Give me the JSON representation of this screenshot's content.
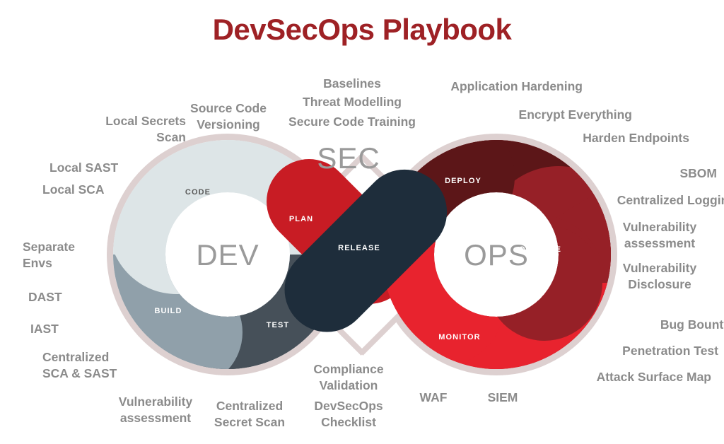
{
  "title": "DevSecOps Playbook",
  "colors": {
    "title": "#9e2125",
    "outer_ring": "#ddd0d0",
    "code": "#dde5e7",
    "build": "#90a0aa",
    "test": "#465059",
    "plan": "#c81c24",
    "release": "#1e2d3b",
    "deploy": "#5c1618",
    "operate": "#962027",
    "monitor": "#e8232e",
    "annotation_text": "#8b8b8b",
    "loop_label_text": "#9a9a9a",
    "background": "#ffffff"
  },
  "loops": {
    "dev": "DEV",
    "sec": "SEC",
    "ops": "OPS"
  },
  "segments": [
    {
      "id": "code",
      "label": "CODE",
      "color": "#dde5e7",
      "text_color": "#5a5a5a"
    },
    {
      "id": "build",
      "label": "BUILD",
      "color": "#90a0aa",
      "text_color": "#ffffff"
    },
    {
      "id": "test",
      "label": "TEST",
      "color": "#465059",
      "text_color": "#ffffff"
    },
    {
      "id": "plan",
      "label": "PLAN",
      "color": "#c81c24",
      "text_color": "#ffffff"
    },
    {
      "id": "release",
      "label": "RELEASE",
      "color": "#1e2d3b",
      "text_color": "#ffffff"
    },
    {
      "id": "deploy",
      "label": "DEPLOY",
      "color": "#5c1618",
      "text_color": "#ffffff"
    },
    {
      "id": "operate",
      "label": "OPERATE",
      "color": "#962027",
      "text_color": "#ffffff"
    },
    {
      "id": "monitor",
      "label": "MONITOR",
      "color": "#e8232e",
      "text_color": "#ffffff"
    }
  ],
  "annotations": {
    "top_left": [
      {
        "id": "local-secrets-scan",
        "text": "Local Secrets\nScan"
      },
      {
        "id": "source-code-versioning",
        "text": "Source Code\nVersioning"
      }
    ],
    "top_center": [
      {
        "id": "baselines",
        "text": "Baselines"
      },
      {
        "id": "threat-modelling",
        "text": "Threat Modelling"
      },
      {
        "id": "secure-code-training",
        "text": "Secure Code Training"
      }
    ],
    "top_right": [
      {
        "id": "application-hardening",
        "text": "Application Hardening"
      },
      {
        "id": "encrypt-everything",
        "text": "Encrypt Everything"
      },
      {
        "id": "harden-endpoints",
        "text": "Harden Endpoints"
      }
    ],
    "left": [
      {
        "id": "local-sast",
        "text": "Local SAST"
      },
      {
        "id": "local-sca",
        "text": "Local SCA"
      },
      {
        "id": "separate-envs",
        "text": "Separate\nEnvs"
      },
      {
        "id": "dast",
        "text": "DAST"
      },
      {
        "id": "iast",
        "text": "IAST"
      },
      {
        "id": "centralized-sca-sast",
        "text": "Centralized\nSCA & SAST"
      }
    ],
    "right": [
      {
        "id": "sbom",
        "text": "SBOM"
      },
      {
        "id": "centralized-logging",
        "text": "Centralized Logging"
      },
      {
        "id": "vulnerability-assessment-ops",
        "text": "Vulnerability\nassessment"
      },
      {
        "id": "vulnerability-disclosure",
        "text": "Vulnerability\nDisclosure"
      },
      {
        "id": "bug-bounty",
        "text": "Bug Bounty"
      },
      {
        "id": "penetration-test",
        "text": "Penetration Test"
      },
      {
        "id": "attack-surface-map",
        "text": "Attack Surface Map"
      }
    ],
    "bottom_left": [
      {
        "id": "vulnerability-assessment-dev",
        "text": "Vulnerability\nassessment"
      },
      {
        "id": "centralized-secret-scan",
        "text": "Centralized\nSecret Scan"
      }
    ],
    "bottom_center": [
      {
        "id": "compliance-validation",
        "text": "Compliance\nValidation"
      },
      {
        "id": "devsecops-checklist",
        "text": "DevSecOps\nChecklist"
      }
    ],
    "bottom_right": [
      {
        "id": "waf",
        "text": "WAF"
      },
      {
        "id": "siem",
        "text": "SIEM"
      }
    ]
  }
}
